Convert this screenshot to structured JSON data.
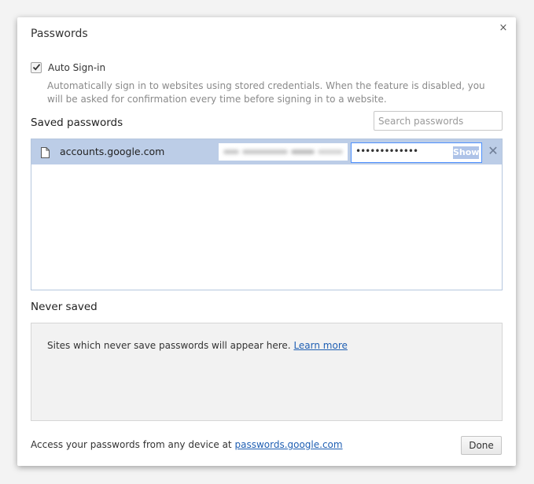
{
  "dialog": {
    "title": "Passwords",
    "close_symbol": "×"
  },
  "auto_signin": {
    "label": "Auto Sign-in",
    "checked": true,
    "description": "Automatically sign in to websites using stored credentials. When the feature is disabled, you will be asked for confirmation every time before signing in to a website."
  },
  "saved_passwords": {
    "heading": "Saved passwords",
    "search_placeholder": "Search passwords",
    "rows": [
      {
        "origin": "accounts.google.com",
        "password_mask": "•••••••••••••",
        "show_label": "Show",
        "delete_symbol": "✕"
      }
    ]
  },
  "never_saved": {
    "heading": "Never saved",
    "empty_text": "Sites which never save passwords will appear here.",
    "learn_more": "Learn more"
  },
  "footer": {
    "text": "Access your passwords from any device at",
    "link": "passwords.google.com",
    "done_label": "Done"
  },
  "colors": {
    "selected_row": "#bccde7",
    "link": "#1f5fb3",
    "focus_border": "#4d90fe"
  }
}
